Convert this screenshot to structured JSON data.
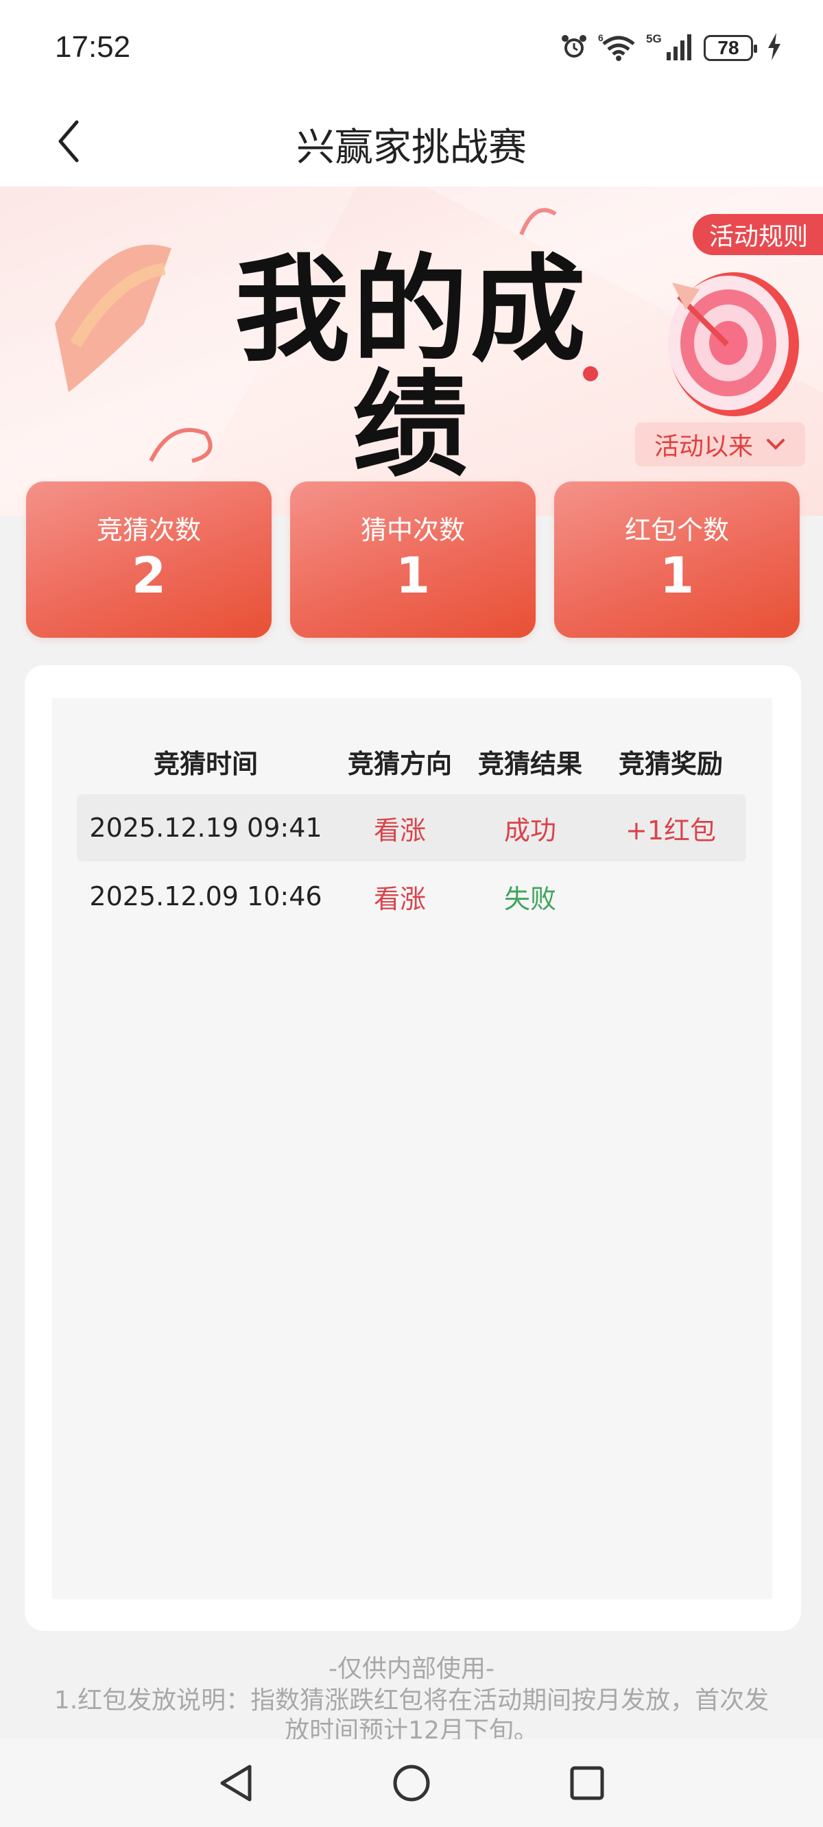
{
  "status_bar": {
    "time": "17:52",
    "battery": "78",
    "icons": [
      "alarm-icon",
      "wifi-icon",
      "signal-5g-icon",
      "battery-icon",
      "charging-icon"
    ]
  },
  "header": {
    "title": "兴赢家挑战赛",
    "back_icon": "chevron-left-icon"
  },
  "hero": {
    "title": "我的成绩",
    "rules_label": "活动规则",
    "period_label": "活动以来",
    "period_icon": "chevron-down-icon"
  },
  "stats": [
    {
      "label": "竞猜次数",
      "value": "2"
    },
    {
      "label": "猜中次数",
      "value": "1"
    },
    {
      "label": "红包个数",
      "value": "1"
    }
  ],
  "table": {
    "headers": [
      "竞猜时间",
      "竞猜方向",
      "竞猜结果",
      "竞猜奖励"
    ],
    "rows": [
      {
        "time": "2025.12.19 09:41",
        "direction": "看涨",
        "result": "成功",
        "reward": "+1红包"
      },
      {
        "time": "2025.12.09 10:46",
        "direction": "看涨",
        "result": "失败",
        "reward": ""
      }
    ]
  },
  "footer": {
    "internal_note": "-仅供内部使用-",
    "note_line1": "1.红包发放说明：指数猜涨跌红包将在活动期间按月发放，首次发",
    "note_line2": "放时间预计12月下旬。"
  },
  "colors": {
    "accent_red": "#e84a4f",
    "success_text": "#d9434a",
    "fail_text": "#3fa55a"
  }
}
